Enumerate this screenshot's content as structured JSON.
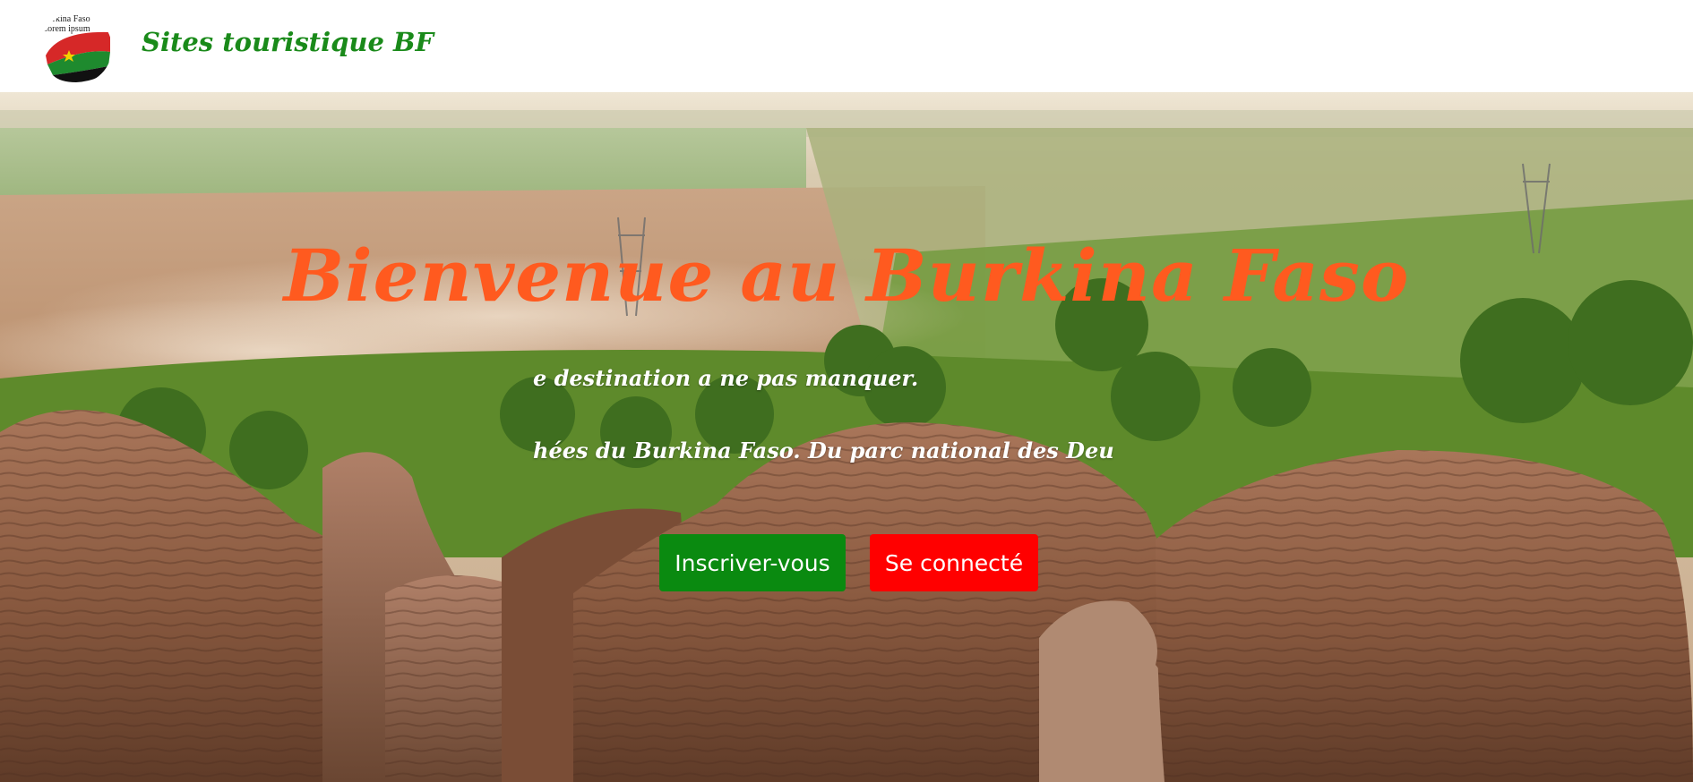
{
  "header": {
    "logo": {
      "icon": "burkina-faso-flag-logo-icon",
      "line1": "Burkina Faso",
      "line2": "Lorem ipsum",
      "colors": {
        "red": "#d62828",
        "green": "#1e8a2e",
        "star": "#f4d000"
      }
    },
    "title": "Sites touristique BF"
  },
  "hero": {
    "background_icon": "landscape-sindou-peaks-icon",
    "title": "Bienvenue au Burkina Faso",
    "tagline1": "e destination a ne pas manquer.",
    "tagline2": "hées du Burkina Faso. Du parc national des Deu",
    "buttons": {
      "signup": "Inscriver-vous",
      "login": "Se connecté"
    }
  },
  "colors": {
    "title_orange": "#ff5a1f",
    "header_green": "#1a8a1a",
    "button_green": "#0a8a10",
    "button_red": "#ff0000"
  }
}
